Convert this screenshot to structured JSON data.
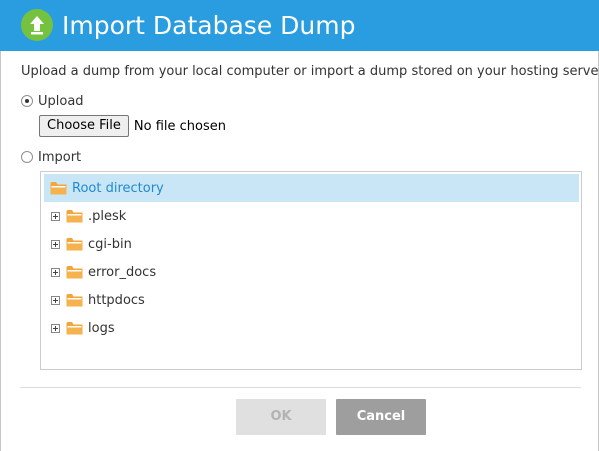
{
  "dialog": {
    "title": "Import Database Dump",
    "title_icon": "upload-arrow-icon",
    "description": "Upload a dump from your local computer or import a dump stored on your hosting server."
  },
  "upload_option": {
    "label": "Upload",
    "selected": true
  },
  "file_input": {
    "button_label": "Choose File",
    "status": "No file chosen"
  },
  "import_option": {
    "label": "Import",
    "selected": false
  },
  "tree": {
    "root": {
      "label": "Root directory",
      "icon": "folder-icon"
    },
    "items": [
      {
        "label": ".plesk"
      },
      {
        "label": "cgi-bin"
      },
      {
        "label": "error_docs"
      },
      {
        "label": "httpdocs"
      },
      {
        "label": "logs"
      }
    ]
  },
  "buttons": {
    "ok": "OK",
    "cancel": "Cancel"
  },
  "colors": {
    "titlebar": "#2a9de0",
    "icon_bg": "#74c23f",
    "selected_row": "#c9e6f7",
    "folder": "#f3a539",
    "root_label": "#1f8ad1"
  }
}
